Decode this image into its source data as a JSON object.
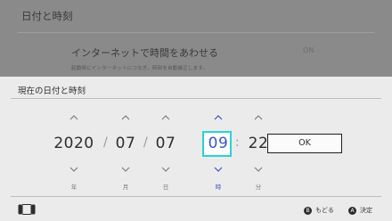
{
  "background": {
    "title": "日付と時刻",
    "row_title": "インターネットで時間をあわせる",
    "row_sub": "起動時にインターネットにつなぎ、時刻を自動補正します。",
    "toggle": "ON"
  },
  "dialog": {
    "title": "現在の日付と時刻",
    "fields": [
      {
        "value": "2020",
        "unit": "年"
      },
      {
        "value": "07",
        "unit": "月"
      },
      {
        "value": "07",
        "unit": "日"
      },
      {
        "value": "09",
        "unit": "時"
      },
      {
        "value": "22",
        "unit": "分"
      }
    ],
    "separators": [
      "/",
      "/",
      ":"
    ],
    "ok_label": "OK",
    "active_field": "時"
  },
  "footer": {
    "back_button": "B",
    "back_label": "もどる",
    "confirm_button": "A",
    "confirm_label": "決定"
  },
  "colors": {
    "accent": "#3b54c8",
    "focus": "#2bd2d2"
  }
}
